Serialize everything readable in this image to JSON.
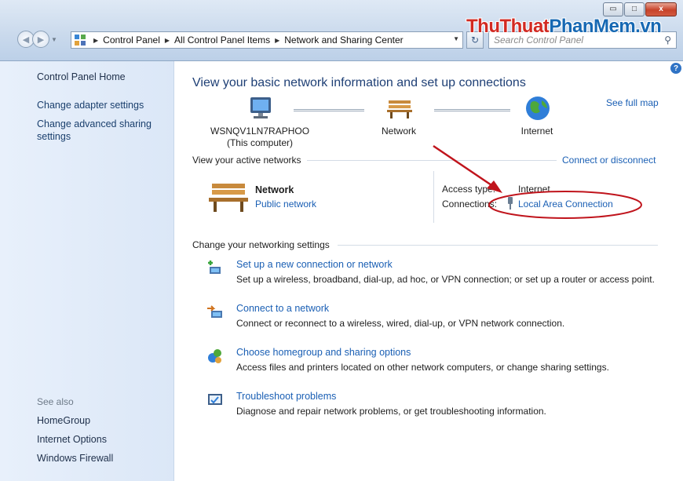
{
  "window": {
    "minimize_glyph": "▭",
    "maximize_glyph": "□",
    "close_glyph": "x"
  },
  "address_bar": {
    "crumbs": [
      "Control Panel",
      "All Control Panel Items",
      "Network and Sharing Center"
    ],
    "search_placeholder": "Search Control Panel"
  },
  "watermark": {
    "part1": "ThuThuat",
    "part2": "PhanMem.vn"
  },
  "sidebar": {
    "home": "Control Panel Home",
    "links": [
      "Change adapter settings",
      "Change advanced sharing settings"
    ],
    "see_also_label": "See also",
    "see_also": [
      "HomeGroup",
      "Internet Options",
      "Windows Firewall"
    ]
  },
  "main": {
    "title": "View your basic network information and set up connections",
    "see_full_map": "See full map",
    "map": {
      "computer_name": "WSNQV1LN7RAPHOO",
      "computer_sub": "(This computer)",
      "network": "Network",
      "internet": "Internet"
    },
    "active_networks_label": "View your active networks",
    "connect_disconnect": "Connect or disconnect",
    "active": {
      "name": "Network",
      "type": "Public network",
      "access_type_label": "Access type:",
      "access_type_value": "Internet",
      "connections_label": "Connections:",
      "connection_value": "Local Area Connection"
    },
    "change_settings_label": "Change your networking settings",
    "tasks": [
      {
        "link": "Set up a new connection or network",
        "desc": "Set up a wireless, broadband, dial-up, ad hoc, or VPN connection; or set up a router or access point."
      },
      {
        "link": "Connect to a network",
        "desc": "Connect or reconnect to a wireless, wired, dial-up, or VPN network connection."
      },
      {
        "link": "Choose homegroup and sharing options",
        "desc": "Access files and printers located on other network computers, or change sharing settings."
      },
      {
        "link": "Troubleshoot problems",
        "desc": "Diagnose and repair network problems, or get troubleshooting information."
      }
    ]
  },
  "colors": {
    "link": "#1a5fb4",
    "annotation": "#c0141c",
    "pane": "#dbe7f7"
  }
}
